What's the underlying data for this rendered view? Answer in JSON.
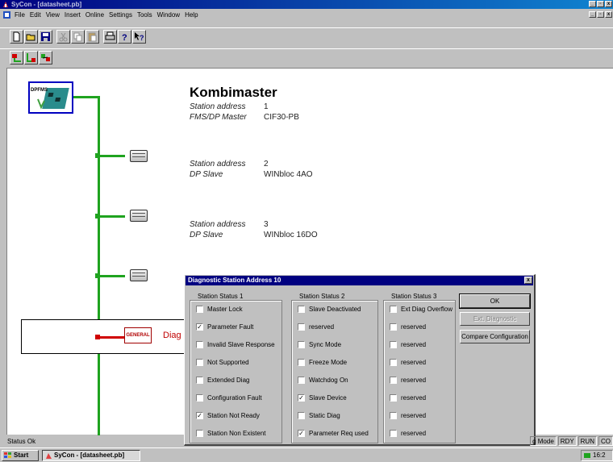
{
  "window": {
    "title": "SyCon - [datasheet.pb]",
    "controls": {
      "minimize": "_",
      "maximize": "▫",
      "close": "x"
    }
  },
  "menu": [
    "File",
    "Edit",
    "View",
    "Insert",
    "Online",
    "Settings",
    "Tools",
    "Window",
    "Help"
  ],
  "toolbar1_icons": [
    "new-file-icon",
    "open-folder-icon",
    "save-icon",
    "cut-icon",
    "copy-icon",
    "paste-icon",
    "print-icon",
    "help-icon",
    "context-help-icon"
  ],
  "toolbar2_icons": [
    "insert-master-icon",
    "insert-slave-icon",
    "config-icon"
  ],
  "stations": {
    "master": {
      "icon_label": "DPFMS",
      "name": "Kombimaster",
      "address_label": "Station address",
      "address": "1",
      "type_label": "FMS/DP Master",
      "type_value": "CIF30-PB"
    },
    "slave2": {
      "address_label": "Station address",
      "address": "2",
      "type_label": "DP Slave",
      "type_value": "WINbloc 4AO"
    },
    "slave3": {
      "address_label": "Station address",
      "address": "3",
      "type_label": "DP Slave",
      "type_value": "WINbloc 16DO"
    },
    "general": {
      "icon_label": "GENERAL",
      "text": "Diag"
    }
  },
  "dialog": {
    "title": "Diagnostic Station Address 10",
    "close": "x",
    "group1": {
      "title": "Station Status 1",
      "items": [
        {
          "label": "Master Lock",
          "checked": false
        },
        {
          "label": "Parameter Fault",
          "checked": true
        },
        {
          "label": "Invalid Slave Response",
          "checked": false
        },
        {
          "label": "Not Supported",
          "checked": false
        },
        {
          "label": "Extended Diag",
          "checked": false
        },
        {
          "label": "Configuration Fault",
          "checked": false
        },
        {
          "label": "Station Not Ready",
          "checked": true
        },
        {
          "label": "Station Non Existent",
          "checked": false
        }
      ]
    },
    "group2": {
      "title": "Station Status 2",
      "items": [
        {
          "label": "Slave Deactivated",
          "checked": false
        },
        {
          "label": "reserved",
          "checked": false
        },
        {
          "label": "Sync Mode",
          "checked": false
        },
        {
          "label": "Freeze Mode",
          "checked": false
        },
        {
          "label": "Watchdog On",
          "checked": false
        },
        {
          "label": "Slave Device",
          "checked": true
        },
        {
          "label": "Static Diag",
          "checked": false
        },
        {
          "label": "Parameter Req used",
          "checked": true
        }
      ]
    },
    "group3": {
      "title": "Station Status 3",
      "items": [
        {
          "label": "Ext Diag Overflow",
          "checked": false
        },
        {
          "label": "reserved",
          "checked": false
        },
        {
          "label": "reserved",
          "checked": false
        },
        {
          "label": "reserved",
          "checked": false
        },
        {
          "label": "reserved",
          "checked": false
        },
        {
          "label": "reserved",
          "checked": false
        },
        {
          "label": "reserved",
          "checked": false
        },
        {
          "label": "reserved",
          "checked": false
        }
      ]
    },
    "buttons": {
      "ok": "OK",
      "ext_diag": "Ext. Diagnostic",
      "compare": "Compare Configuration"
    }
  },
  "statusbar": {
    "text": "Status Ok",
    "cells": [
      "g Mode",
      "RDY",
      "RUN",
      "CO"
    ]
  },
  "taskbar": {
    "start": "Start",
    "task": "SyCon - [datasheet.pb]",
    "clock": "16:2"
  },
  "colors": {
    "bus": "#1fa31f",
    "error": "#d00000",
    "titlebar": "#000080"
  }
}
